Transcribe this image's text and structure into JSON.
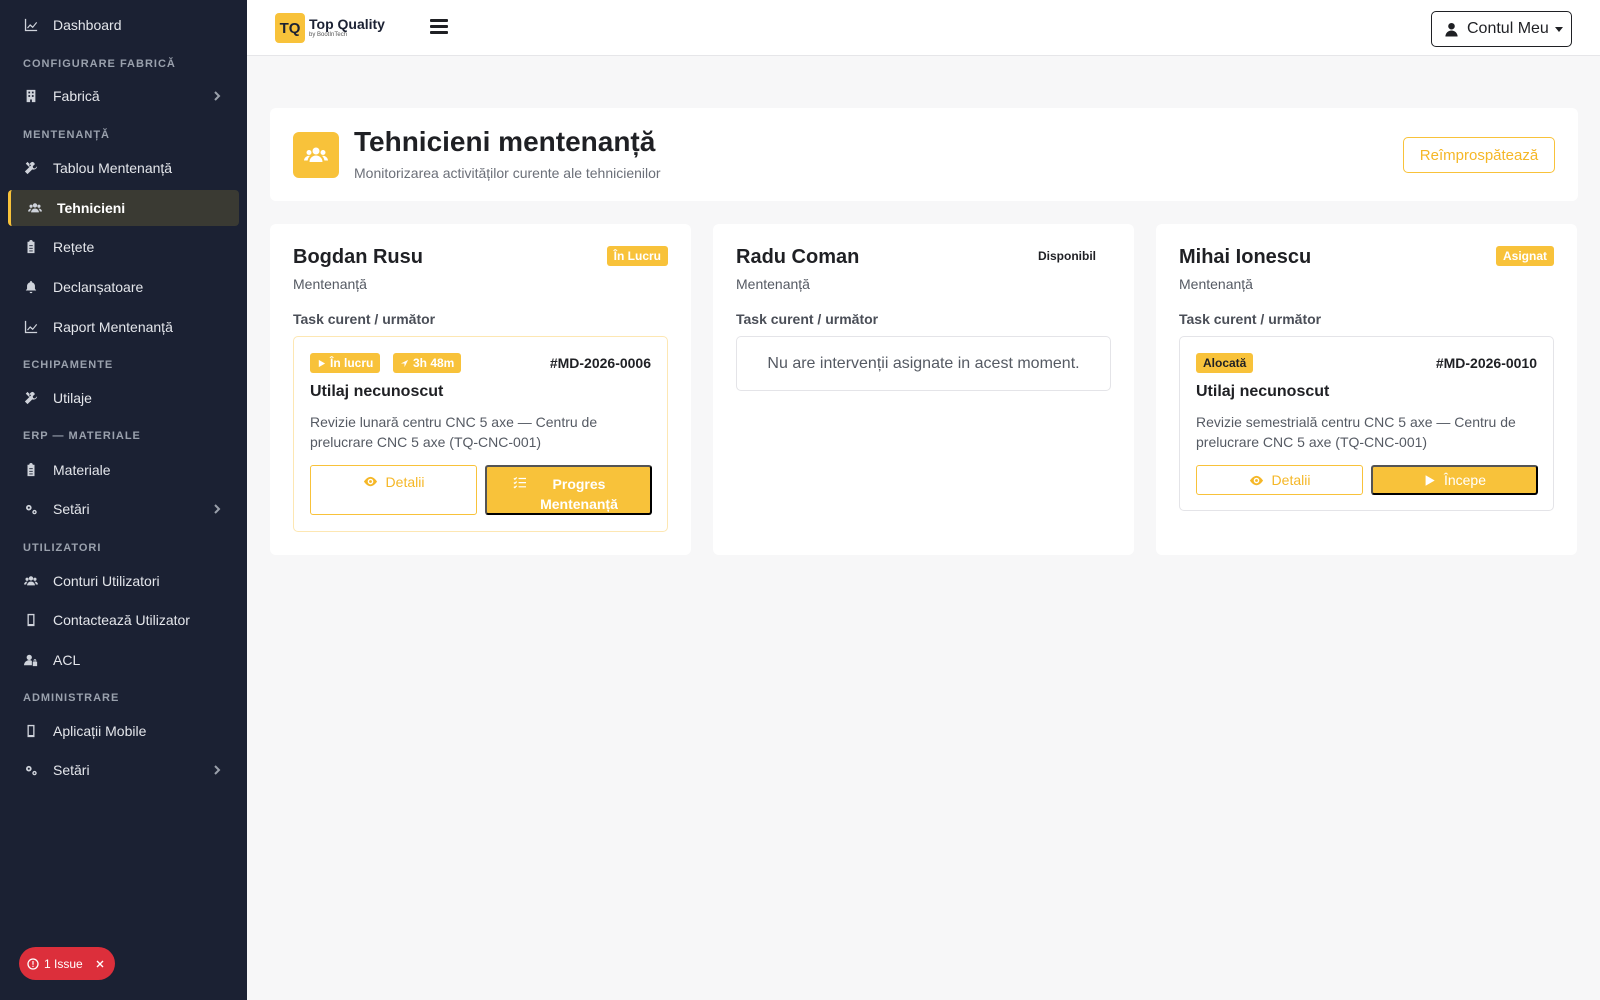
{
  "sidebar": {
    "dashboard": "Dashboard",
    "sections": {
      "factory_config": "CONFIGURARE FABRICĂ",
      "maintenance": "MENTENANȚĂ",
      "equipment": "ECHIPAMENTE",
      "erp": "ERP — MATERIALE",
      "users": "UTILIZATORI",
      "admin": "ADMINISTRARE"
    },
    "items": {
      "factory": "Fabrică",
      "maintenance_board": "Tablou Mentenanță",
      "technicians": "Tehnicieni",
      "recipes": "Rețete",
      "triggers": "Declanșatoare",
      "maintenance_report": "Raport Mentenanță",
      "machines": "Utilaje",
      "materials": "Materiale",
      "settings_erp": "Setări",
      "user_accounts": "Conturi Utilizatori",
      "contact_user": "Contactează Utilizator",
      "acl": "ACL",
      "mobile_apps": "Aplicații Mobile",
      "settings_admin": "Setări"
    },
    "issue_badge": "1 Issue"
  },
  "topbar": {
    "logo_box": "TQ",
    "logo_title": "Top Quality",
    "logo_sub": "by BootInTech",
    "account_label": "Contul Meu"
  },
  "header": {
    "title": "Tehnicieni mentenanță",
    "subtitle": "Monitorizarea activităților curente ale tehnicienilor",
    "refresh_label": "Reîmprospătează"
  },
  "technicians": [
    {
      "name": "Bogdan Rusu",
      "role": "Mentenanță",
      "status": "În Lucru",
      "task_label": "Task curent / următor",
      "task": {
        "state_chip": "În lucru",
        "time_chip": "3h 48m",
        "id": "#MD-2026-0006",
        "title": "Utilaj necunoscut",
        "description": "Revizie lunară centru CNC 5 axe — Centru de prelucrare CNC 5 axe (TQ-CNC-001)",
        "details_label": "Detalii",
        "action_label": "Progres Mentenanță"
      }
    },
    {
      "name": "Radu Coman",
      "role": "Mentenanță",
      "status": "Disponibil",
      "task_label": "Task curent / următor",
      "empty_message": "Nu are intervenții asignate in acest moment."
    },
    {
      "name": "Mihai Ionescu",
      "role": "Mentenanță",
      "status": "Asignat",
      "task_label": "Task curent / următor",
      "task": {
        "state_chip": "Alocată",
        "id": "#MD-2026-0010",
        "title": "Utilaj necunoscut",
        "description": "Revizie semestrială centru CNC 5 axe — Centru de prelucrare CNC 5 axe (TQ-CNC-001)",
        "details_label": "Detalii",
        "action_label": "Începe"
      }
    }
  ],
  "colors": {
    "sidebar_bg": "#1b2133",
    "accent": "#f8c23a",
    "danger": "#dc2f3b"
  }
}
